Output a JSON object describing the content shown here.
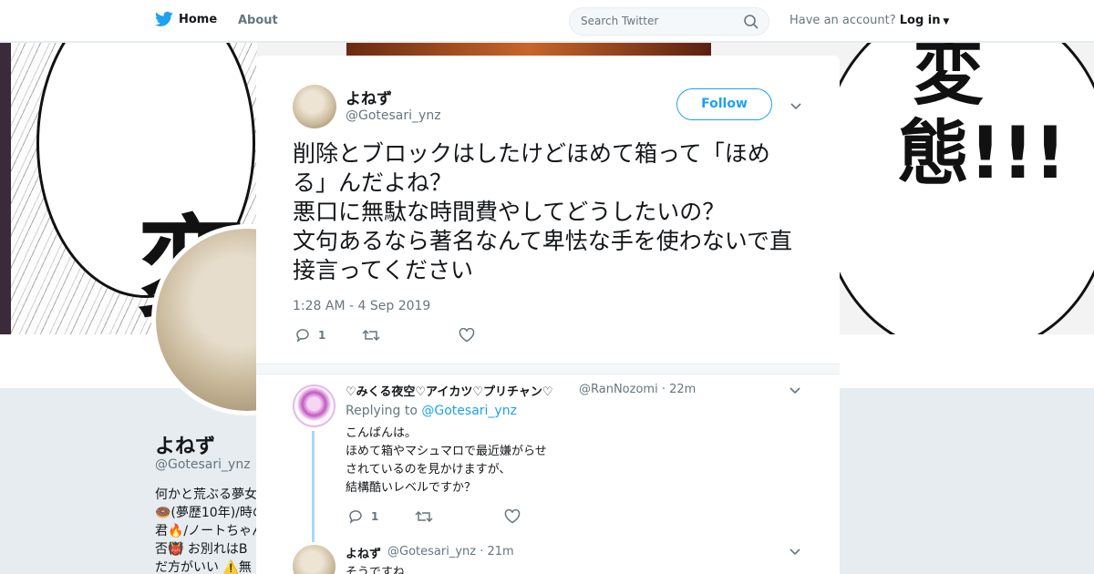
{
  "nav": {
    "home_label": "Home",
    "about_label": "About",
    "search_placeholder": "Search Twitter",
    "account_prompt": "Have an account?",
    "login_label": "Log in"
  },
  "colors": {
    "brand": "#1da1f2",
    "muted": "#66757f",
    "text": "#14171a",
    "thread": "#a7d8f8"
  },
  "profile": {
    "name": "よねず",
    "handle": "@Gotesari_ynz",
    "bio_lines": [
      "何かと荒ぶる夢女",
      "🍩(夢歴10年)/時の",
      "君🔥/ノートちゃん",
      "否👹 お別れはB",
      "だ方がいい ⚠️無"
    ],
    "banner_left_text": "変",
    "banner_right_text": "変態!!!"
  },
  "tweet": {
    "author_name": "よねず",
    "author_handle": "@Gotesari_ynz",
    "follow_label": "Follow",
    "text": "削除とブロックはしたけどほめて箱って「ほめる」んだよね？\n悪口に無駄な時間費やしてどうしたいの？\n文句あるなら著名なんて卑怯な手を使わないで直接言ってください",
    "timestamp": "1:28 AM - 4 Sep 2019",
    "reply_count": "1",
    "retweet_count": "",
    "like_count": ""
  },
  "replies": [
    {
      "name": "♡みくる夜空♡アイカツ♡プリチャン♡",
      "handle": "@RanNozomi",
      "time": "22m",
      "replying_prefix": "Replying to",
      "replying_to": "@Gotesari_ynz",
      "body_lines": [
        "こんばんは。",
        "ほめて箱やマシュマロで最近嫌がらせ",
        "されているのを見かけますが、",
        "結構酷いレベルですか？"
      ],
      "reply_count": "1"
    },
    {
      "name": "よねず",
      "handle": "@Gotesari_ynz",
      "time": "21m",
      "body": "そうですね..."
    }
  ]
}
